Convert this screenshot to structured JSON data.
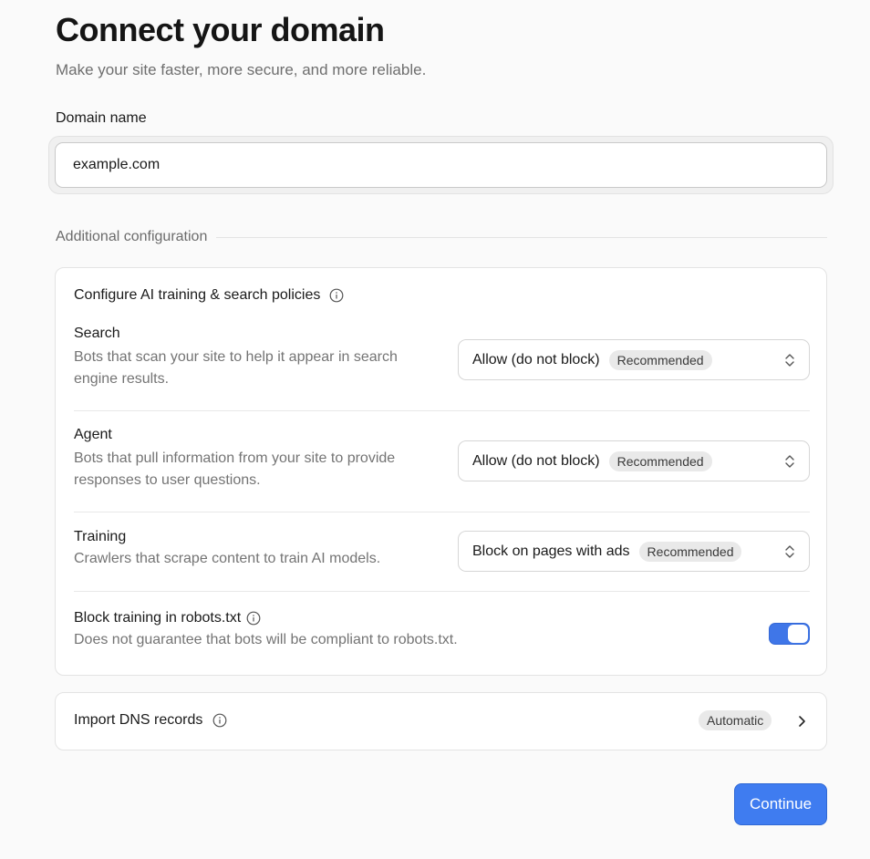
{
  "header": {
    "title": "Connect your domain",
    "subtitle": "Make your site faster, more secure, and more reliable."
  },
  "domain": {
    "label": "Domain name",
    "value": "example.com",
    "placeholder": ""
  },
  "additional": {
    "heading": "Additional configuration"
  },
  "ai_policies": {
    "title": "Configure AI training & search policies",
    "rows": [
      {
        "title": "Search",
        "description": "Bots that scan your site to help it appear in search engine results.",
        "selected": "Allow (do not block)",
        "badge": "Recommended"
      },
      {
        "title": "Agent",
        "description": "Bots that pull information from your site to provide responses to user questions.",
        "selected": "Allow (do not block)",
        "badge": "Recommended"
      },
      {
        "title": "Training",
        "description": "Crawlers that scrape content to train AI models.",
        "selected": "Block on pages with ads",
        "badge": "Recommended"
      }
    ],
    "robots": {
      "title": "Block training in robots.txt",
      "description": "Does not guarantee that bots will be compliant to robots.txt.",
      "enabled": true
    }
  },
  "dns": {
    "label": "Import DNS records",
    "badge": "Automatic"
  },
  "actions": {
    "continue_label": "Continue"
  },
  "colors": {
    "accent": "#3f7cf0",
    "toggle_on": "#3f76e8"
  }
}
